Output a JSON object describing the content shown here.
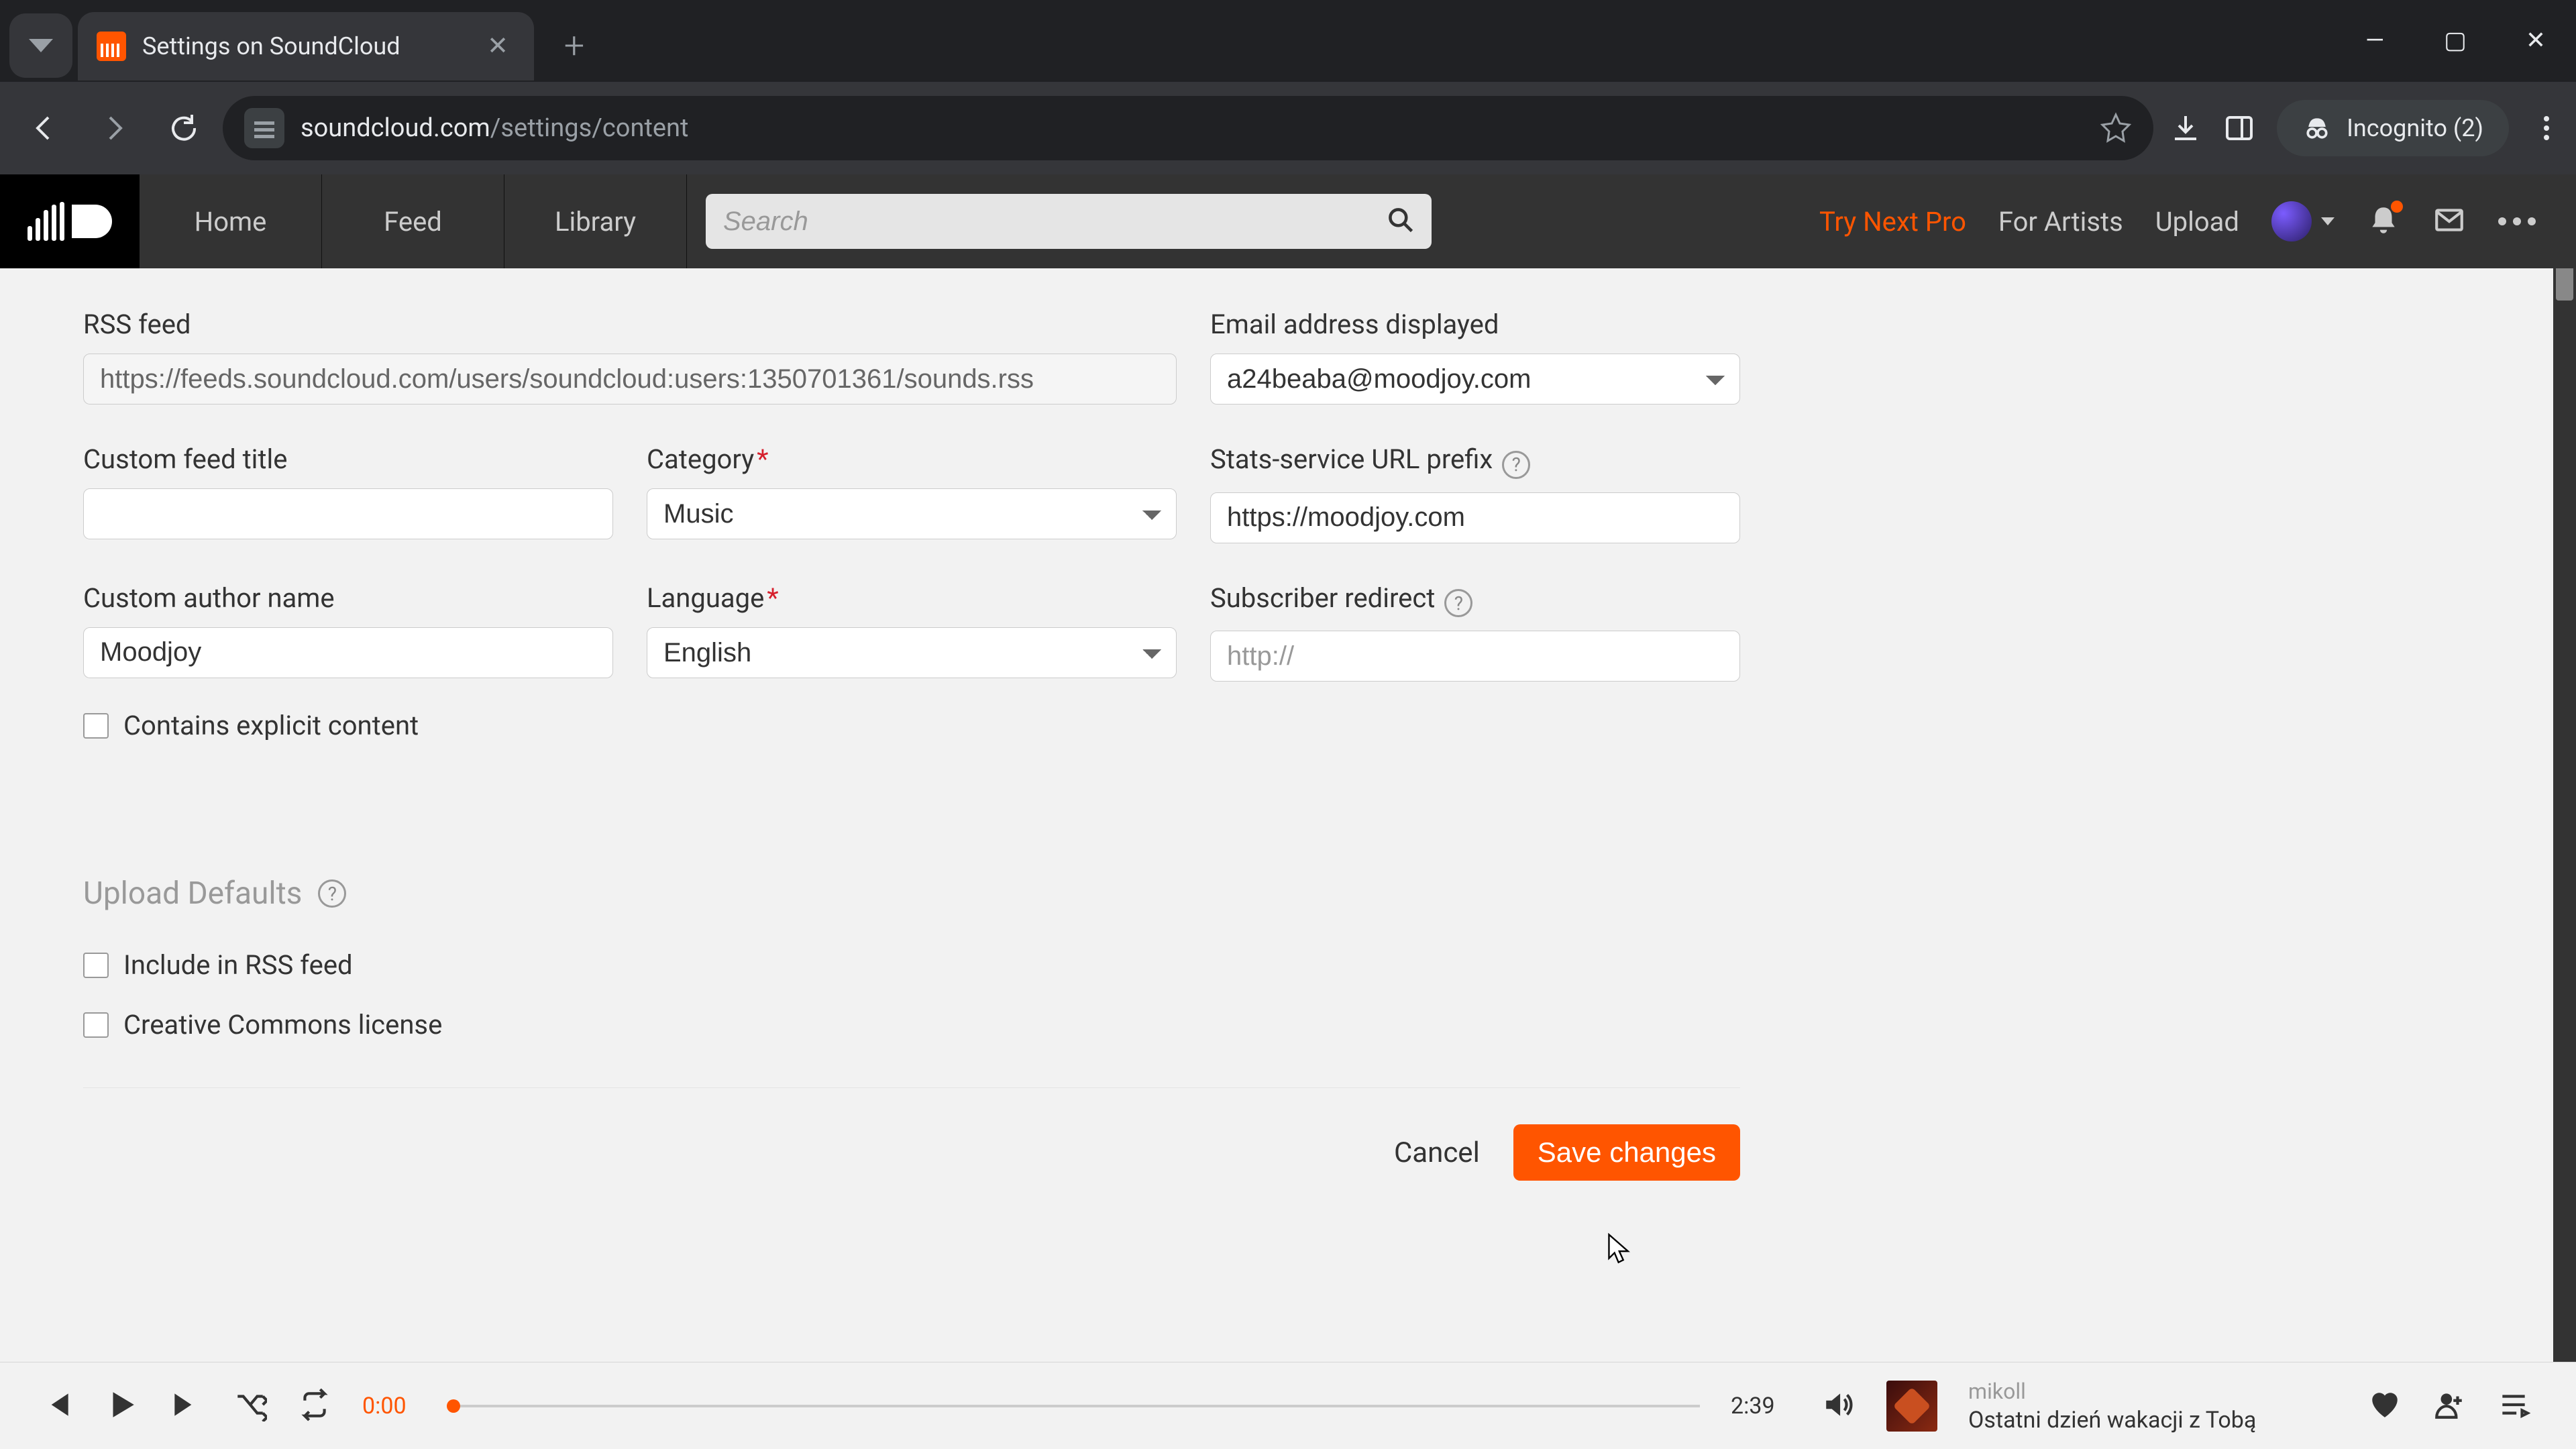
{
  "browser": {
    "tab_title": "Settings on SoundCloud",
    "url_domain": "soundcloud.com",
    "url_path": "/settings/content",
    "incognito_label": "Incognito (2)"
  },
  "topbar": {
    "nav": {
      "home": "Home",
      "feed": "Feed",
      "library": "Library"
    },
    "search_placeholder": "Search",
    "try_next_pro": "Try Next Pro",
    "for_artists": "For Artists",
    "upload": "Upload"
  },
  "form": {
    "rss_feed": {
      "label": "RSS feed",
      "value": "https://feeds.soundcloud.com/users/soundcloud:users:1350701361/sounds.rss"
    },
    "email_displayed": {
      "label": "Email address displayed",
      "value": "a24beaba@moodjoy.com"
    },
    "custom_feed_title": {
      "label": "Custom feed title",
      "value": ""
    },
    "category": {
      "label": "Category",
      "value": "Music"
    },
    "stats_prefix": {
      "label": "Stats-service URL prefix",
      "value": "https://moodjoy.com"
    },
    "custom_author": {
      "label": "Custom author name",
      "value": "Moodjoy"
    },
    "language": {
      "label": "Language",
      "value": "English"
    },
    "subscriber_redirect": {
      "label": "Subscriber redirect",
      "placeholder": "http://",
      "value": ""
    },
    "explicit_label": "Contains explicit content",
    "upload_defaults_header": "Upload Defaults",
    "include_rss_label": "Include in RSS feed",
    "cc_license_label": "Creative Commons license",
    "cancel": "Cancel",
    "save": "Save changes"
  },
  "player": {
    "current_time": "0:00",
    "total_time": "2:39",
    "artist": "mikoll",
    "track_title": "Ostatni dzień wakacji z Tobą"
  }
}
